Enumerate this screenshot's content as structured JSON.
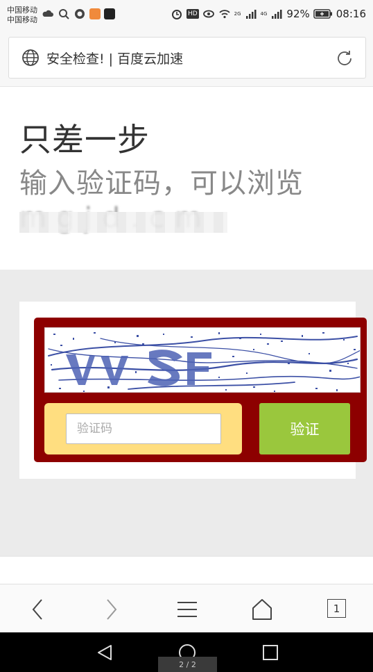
{
  "status_bar": {
    "carrier_1": "中国移动",
    "carrier_2": "中国移动",
    "signal_1_label": "2G",
    "signal_2_label": "4G",
    "battery": "92%",
    "time": "08:16",
    "hd_badge": "HD"
  },
  "address_bar": {
    "title": "安全检查! | 百度云加速",
    "globe_icon": "globe-icon",
    "reload_icon": "reload-icon"
  },
  "header": {
    "title": "只差一步",
    "subtitle": "输入验证码，可以浏览",
    "site_obscured": "m  g  j  d  .  c  m"
  },
  "captcha": {
    "input_placeholder": "验证码",
    "submit_label": "验证",
    "colors": {
      "frame": "#8d0000",
      "input_panel": "#ffde80",
      "button": "#9ac73d",
      "noise": "#3b4fa5"
    }
  },
  "toolbar": {
    "back_icon": "chevron-left-icon",
    "forward_icon": "chevron-right-icon",
    "menu_icon": "menu-icon",
    "home_icon": "home-icon",
    "tab_count": "1"
  },
  "nav_bar": {
    "page_indicator": "2 / 2"
  }
}
